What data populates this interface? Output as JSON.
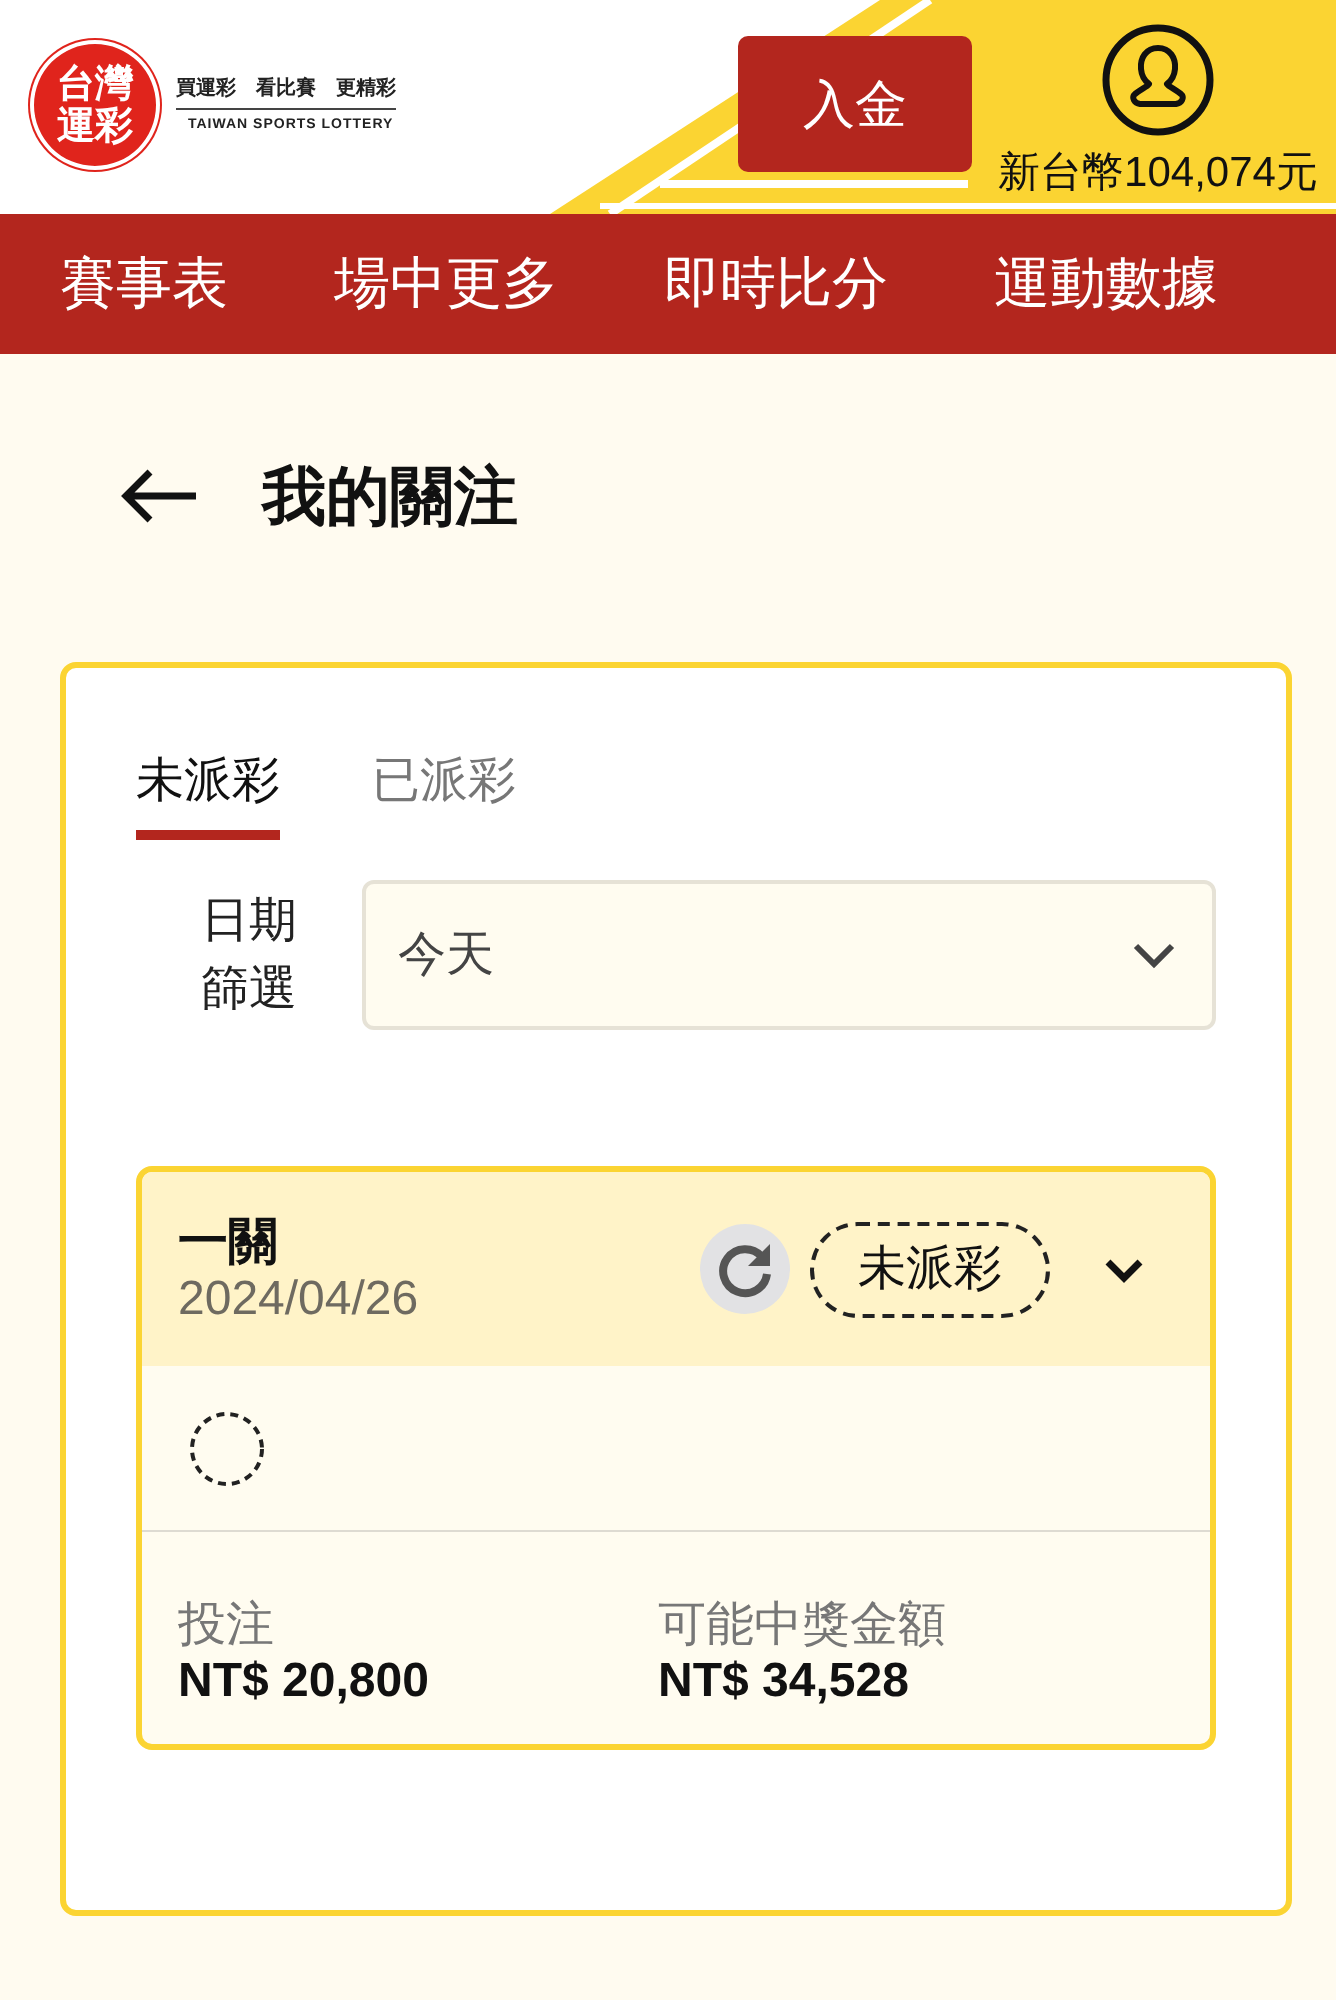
{
  "header": {
    "logo": {
      "mark": "台灣運彩",
      "tagline": "買運彩　看比賽　更精彩",
      "subtitle": "TAIWAN SPORTS LOTTERY"
    },
    "deposit_button": "入金",
    "balance": "新台幣104,074元"
  },
  "nav": [
    {
      "label": "賽事表"
    },
    {
      "label": "場中更多"
    },
    {
      "label": "即時比分"
    },
    {
      "label": "運動數據"
    }
  ],
  "page_title": "我的關注",
  "tabs": [
    {
      "label": "未派彩",
      "selected": true
    },
    {
      "label": "已派彩",
      "selected": false
    }
  ],
  "date_filter": {
    "label": "日期篩選",
    "value": "今天"
  },
  "bets": [
    {
      "type": "一關",
      "date": "2024/04/26",
      "status": "未派彩",
      "stake_label": "投注",
      "stake": "NT$ 20,800",
      "payout_label": "可能中獎金額",
      "payout": "NT$ 34,528"
    }
  ]
}
